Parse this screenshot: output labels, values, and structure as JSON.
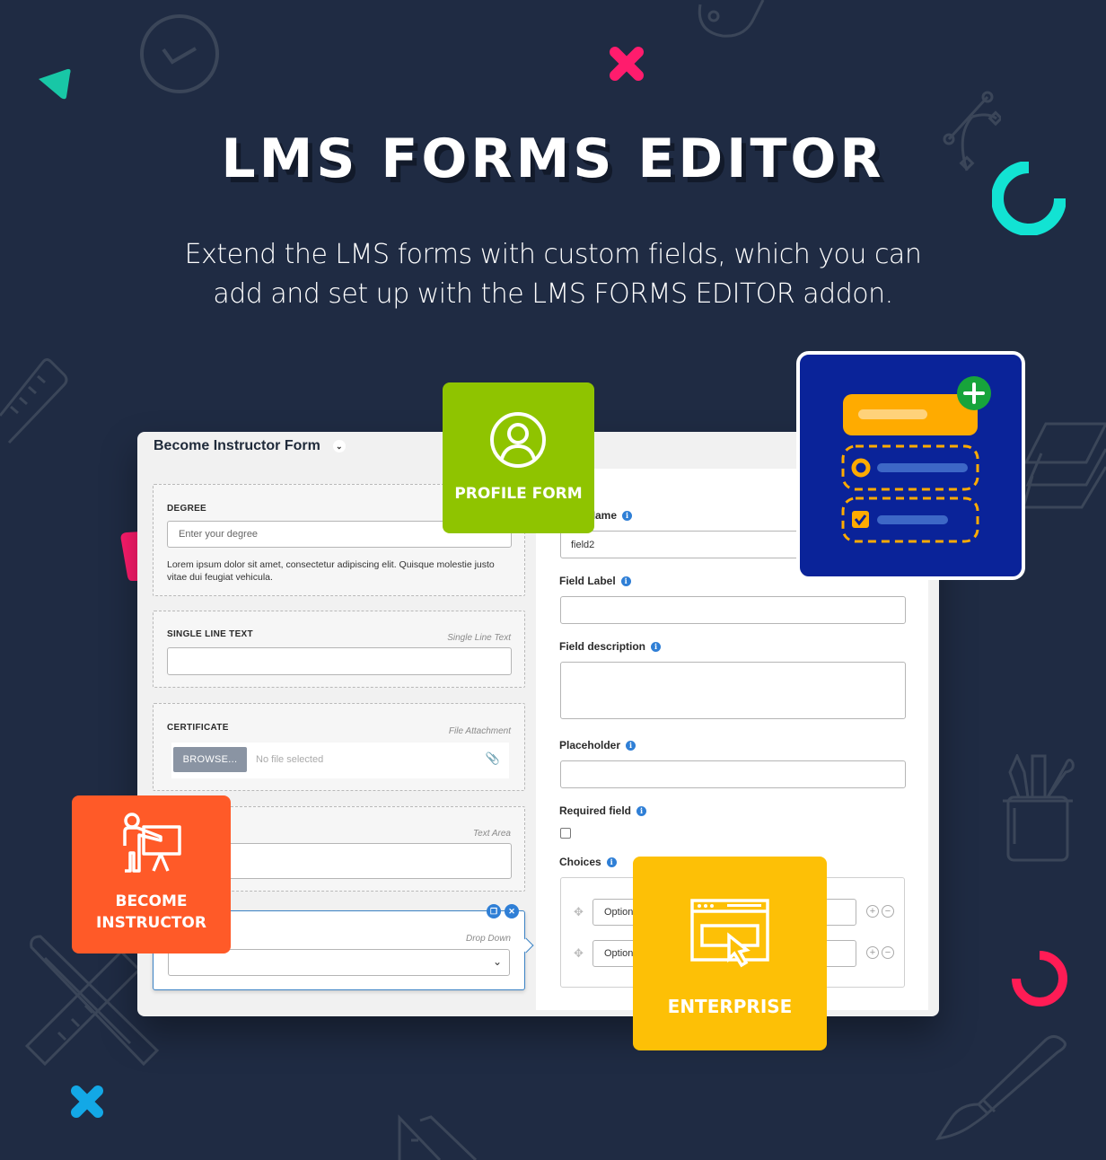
{
  "hero": {
    "title": "LMS FORMS EDITOR",
    "subtitle_line1": "Extend the LMS forms with custom fields, which you can",
    "subtitle_line2": "add and set up with the LMS FORMS EDITOR addon."
  },
  "form_panel": {
    "form_selector": "Become Instructor Form",
    "fields": [
      {
        "label": "DEGREE",
        "type": "",
        "placeholder": "Enter your degree",
        "help": "Lorem ipsum dolor sit amet, consectetur adipiscing elit. Quisque molestie justo vitae dui feugiat vehicula."
      },
      {
        "label": "SINGLE LINE TEXT",
        "type": "Single Line Text"
      },
      {
        "label": "CERTIFICATE",
        "type": "File Attachment",
        "browse_label": "BROWSE...",
        "file_status": "No file selected"
      },
      {
        "label": "",
        "type": "Text Area"
      },
      {
        "label": "",
        "type": "Drop Down"
      }
    ]
  },
  "settings": {
    "field_name_label": "Field Name",
    "field_name_value": "field2",
    "field_label_label": "Field Label",
    "field_label_value": "",
    "field_description_label": "Field description",
    "placeholder_label": "Placeholder",
    "required_label": "Required field",
    "required_checked": false,
    "choices_label": "Choices",
    "choices": [
      {
        "value": "Option"
      },
      {
        "value": "Option"
      }
    ]
  },
  "badges": {
    "profile_form": "PROFILE FORM",
    "become_instructor_line1": "BECOME",
    "become_instructor_line2": "INSTRUCTOR",
    "enterprise": "ENTERPRISE"
  },
  "colors": {
    "background": "#1f2b43",
    "profile_green": "#8fc400",
    "instructor_orange": "#ff5a28",
    "enterprise_yellow": "#fdc006",
    "builder_blue": "#0a2399",
    "accent_blue": "#2f7fd6"
  }
}
